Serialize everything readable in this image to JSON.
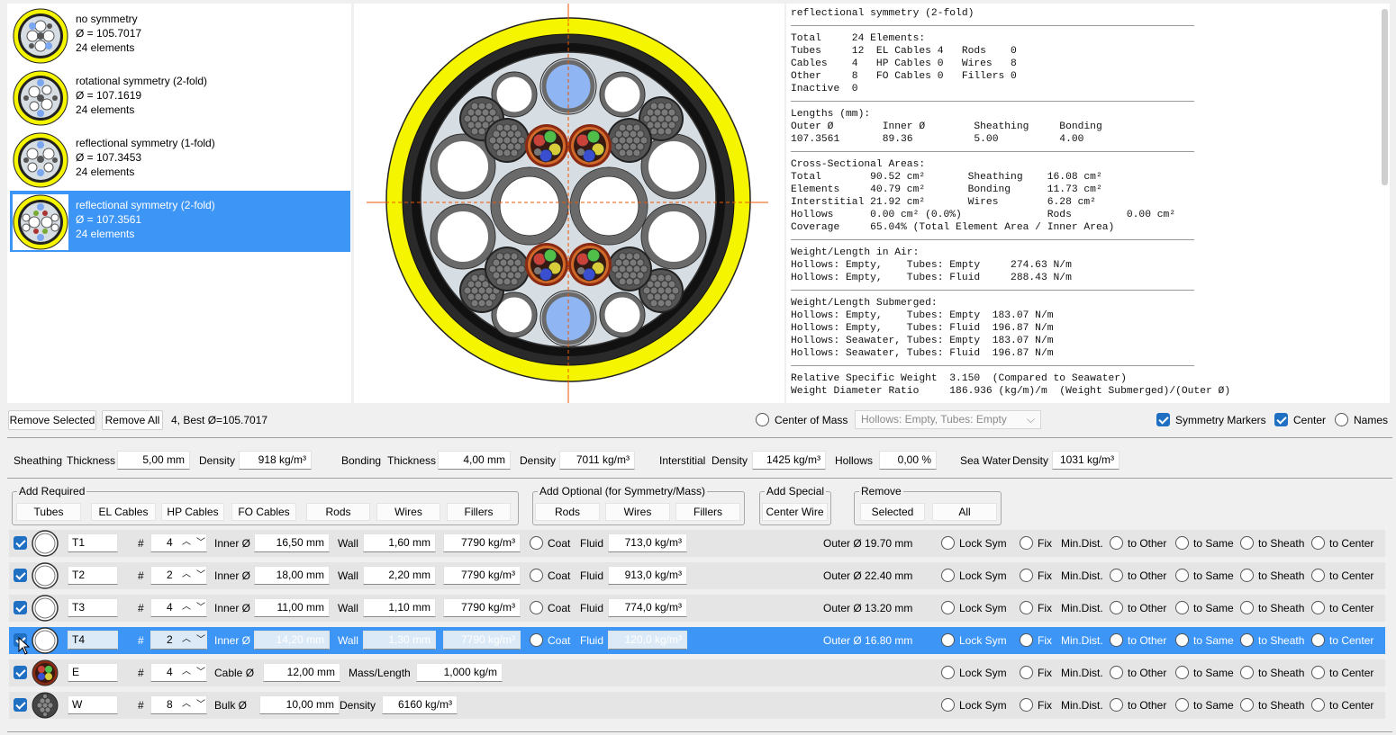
{
  "solutions": [
    {
      "name": "no symmetry",
      "diameter": "Ø = 105.7017",
      "elements": "24 elements"
    },
    {
      "name": "rotational symmetry (2-fold)",
      "diameter": "Ø = 107.1619",
      "elements": "24 elements"
    },
    {
      "name": "reflectional symmetry (1-fold)",
      "diameter": "Ø = 107.3453",
      "elements": "24 elements"
    },
    {
      "name": "reflectional symmetry (2-fold)",
      "diameter": "Ø = 107.3561",
      "elements": "24 elements"
    }
  ],
  "report": {
    "title": "reflectional symmetry (2-fold)",
    "counts": "Total     24 Elements:\nTubes     12  EL Cables 4   Rods    0\nCables    4   HP Cables 0   Wires   8\nOther     8   FO Cables 0   Fillers 0\nInactive  0",
    "lengths": "Lengths (mm):\nOuter Ø        Inner Ø        Sheathing     Bonding\n107.3561       89.36          5.00          4.00",
    "areas": "Cross-Sectional Areas:\nTotal        90.52 cm²       Sheathing    16.08 cm²\nElements     40.79 cm²       Bonding      11.73 cm²\nInterstitial 21.92 cm²       Wires        6.28 cm²\nHollows      0.00 cm² (0.0%)              Rods         0.00 cm²\nCoverage     65.04% (Total Element Area / Inner Area)",
    "weight_air": "Weight/Length in Air:\nHollows: Empty,    Tubes: Empty     274.63 N/m\nHollows: Empty,    Tubes: Fluid     288.43 N/m",
    "weight_sub": "Weight/Length Submerged:\nHollows: Empty,    Tubes: Empty  183.07 N/m\nHollows: Empty,    Tubes: Fluid  196.87 N/m\nHollows: Seawater, Tubes: Empty  183.07 N/m\nHollows: Seawater, Tubes: Fluid  196.87 N/m",
    "ratios": "Relative Specific Weight  3.150  (Compared to Seawater)\nWeight Diameter Ratio     186.936 (kg/m)/m  (Weight Submerged)/(Outer Ø)"
  },
  "toolbar": {
    "remove_selected": "Remove Selected",
    "remove_all": "Remove All",
    "best_info": "4, Best Ø=105.7017",
    "center_of_mass": "Center of Mass",
    "hollows_select": "Hollows: Empty, Tubes: Empty",
    "symmetry_markers": "Symmetry Markers",
    "center": "Center",
    "names": "Names"
  },
  "params": {
    "sheathing": "Sheathing",
    "thickness": "Thickness",
    "density": "Density",
    "sheath_thickness": "5,00 mm",
    "sheath_density": "918 kg/m³",
    "bonding": "Bonding",
    "bond_thickness": "4,00 mm",
    "bond_density": "7011 kg/m³",
    "interstitial": "Interstitial",
    "inter_density": "1425 kg/m³",
    "hollows": "Hollows",
    "hollows_pct": "0,00 %",
    "sea_water": "Sea Water",
    "sea_density": "1031 kg/m³"
  },
  "groups": {
    "add_required": "Add Required",
    "tubes": "Tubes",
    "el_cables": "EL Cables",
    "hp_cables": "HP Cables",
    "fo_cables": "FO Cables",
    "rods": "Rods",
    "wires": "Wires",
    "fillers": "Fillers",
    "add_optional": "Add Optional (for Symmetry/Mass)",
    "opt_rods": "Rods",
    "opt_wires": "Wires",
    "opt_fillers": "Fillers",
    "add_special": "Add Special",
    "center_wire": "Center Wire",
    "remove": "Remove",
    "selected": "Selected",
    "all": "All"
  },
  "labels": {
    "hash": "#",
    "inner": "Inner Ø",
    "wall": "Wall",
    "coat": "Coat",
    "fluid": "Fluid",
    "cable_d": "Cable Ø",
    "mass_length": "Mass/Length",
    "bulk_d": "Bulk Ø",
    "density": "Density",
    "lock_sym": "Lock Sym",
    "fix": "Fix",
    "min_dist": "Min.Dist.",
    "to_other": "to Other",
    "to_same": "to Same",
    "to_sheath": "to Sheath",
    "to_center": "to Center"
  },
  "rows": [
    {
      "name": "T1",
      "count": "4",
      "inner": "16,50 mm",
      "wall": "1,60 mm",
      "density": "7790 kg/m³",
      "fluid": "713,0 kg/m³",
      "outer": "Outer Ø 19.70 mm"
    },
    {
      "name": "T2",
      "count": "2",
      "inner": "18,00 mm",
      "wall": "2,20 mm",
      "density": "7790 kg/m³",
      "fluid": "913,0 kg/m³",
      "outer": "Outer Ø 22.40 mm"
    },
    {
      "name": "T3",
      "count": "4",
      "inner": "11,00 mm",
      "wall": "1,10 mm",
      "density": "7790 kg/m³",
      "fluid": "774,0 kg/m³",
      "outer": "Outer Ø 13.20 mm"
    },
    {
      "name": "T4",
      "count": "2",
      "inner": "14,20 mm",
      "wall": "1,30 mm",
      "density": "7790 kg/m³",
      "fluid": "120,0 kg/m³",
      "outer": "Outer Ø 16.80 mm"
    },
    {
      "name": "E",
      "count": "4",
      "cable_d": "12,00 mm",
      "mass": "1,000 kg/m"
    },
    {
      "name": "W",
      "count": "8",
      "bulk_d": "10,00 mm",
      "density": "6160 kg/m³"
    }
  ],
  "colors": {
    "selection": "#3d95f6",
    "sheath": "#f5f500",
    "bonding": "#1a1a1a",
    "filler": "#d6dde3",
    "accent": "#1f6fc2"
  }
}
